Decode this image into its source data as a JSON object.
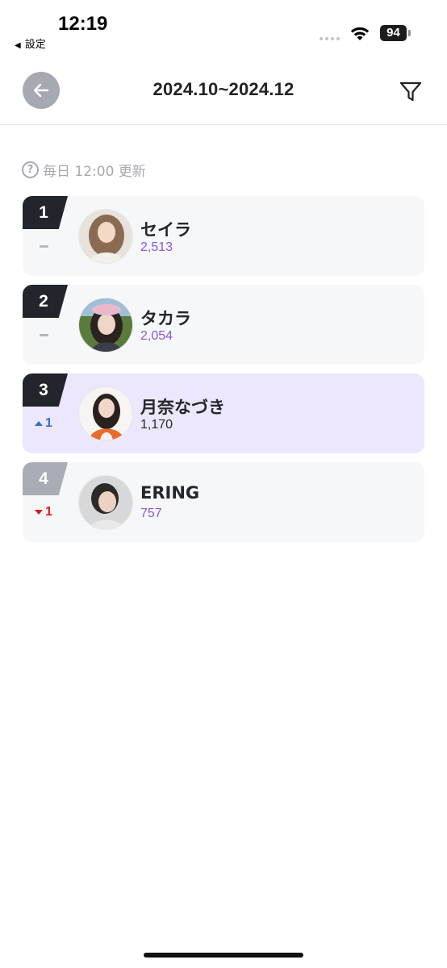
{
  "status_bar": {
    "time": "12:19",
    "back_app": "設定",
    "battery": "94"
  },
  "header": {
    "title": "2024.10~2024.12",
    "back_icon": "arrow-left-icon",
    "filter_icon": "filter-icon"
  },
  "update_note": "毎日 12:00 更新",
  "rankings": [
    {
      "rank": "1",
      "change": "",
      "change_dir": "same",
      "name": "セイラ",
      "score": "2,513",
      "highlighted": false
    },
    {
      "rank": "2",
      "change": "",
      "change_dir": "same",
      "name": "タカラ",
      "score": "2,054",
      "highlighted": false
    },
    {
      "rank": "3",
      "change": "1",
      "change_dir": "up",
      "name": "月奈なづき",
      "score": "1,170",
      "highlighted": true
    },
    {
      "rank": "4",
      "change": "1",
      "change_dir": "down",
      "name": "ERING",
      "score": "757",
      "highlighted": false
    }
  ],
  "colors": {
    "accent_purple": "#8a56d8",
    "highlight_bg": "#ece7fd",
    "rank_up": "#2f6fdc",
    "rank_down": "#e01c1c"
  }
}
